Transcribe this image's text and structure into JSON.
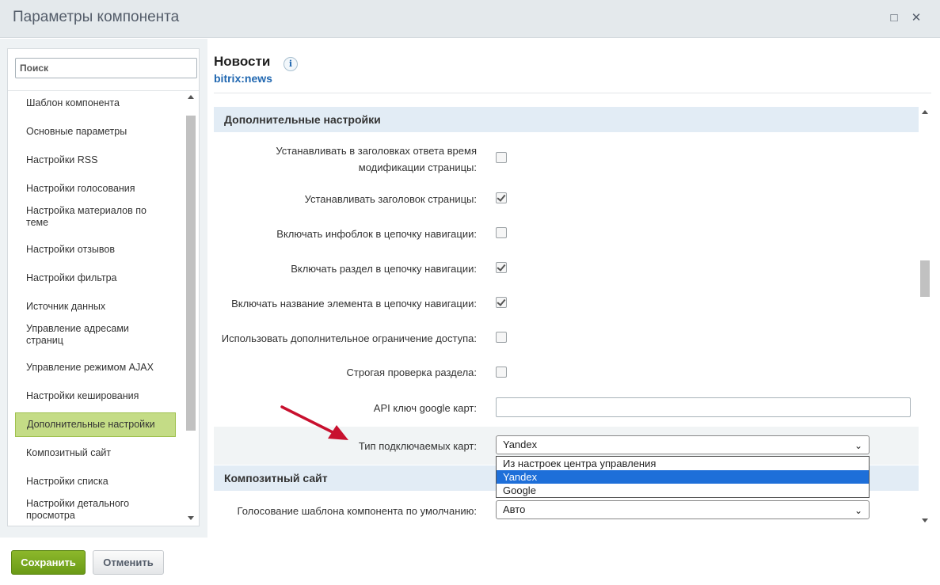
{
  "window": {
    "title": "Параметры компонента"
  },
  "sidebar": {
    "search_placeholder": "Поиск",
    "items": [
      "Шаблон компонента",
      "Основные параметры",
      "Настройки RSS",
      "Настройки голосования",
      "Настройка материалов по теме",
      "Настройки отзывов",
      "Настройки фильтра",
      "Источник данных",
      "Управление адресами страниц",
      "Управление режимом AJAX",
      "Настройки кеширования",
      "Дополнительные настройки",
      "Композитный сайт",
      "Настройки списка",
      "Настройки детального просмотра"
    ],
    "active_item": "Дополнительные настройки"
  },
  "component": {
    "title": "Новости",
    "code": "bitrix:news"
  },
  "sections": {
    "additional": {
      "title": "Дополнительные настройки",
      "rows": [
        {
          "label": "Устанавливать в заголовках ответа время модификации страницы:",
          "checked": false
        },
        {
          "label": "Устанавливать заголовок страницы:",
          "checked": true
        },
        {
          "label": "Включать инфоблок в цепочку навигации:",
          "checked": false
        },
        {
          "label": "Включать раздел в цепочку навигации:",
          "checked": true
        },
        {
          "label": "Включать название элемента в цепочку навигации:",
          "checked": true
        },
        {
          "label": "Использовать дополнительное ограничение доступа:",
          "checked": false
        },
        {
          "label": "Строгая проверка раздела:",
          "checked": false
        }
      ],
      "api_key_label": "API ключ google карт:",
      "api_key_value": "",
      "map_type_label": "Тип подключаемых карт:",
      "map_type_value": "Yandex",
      "map_type_options": [
        "Из настроек центра управления",
        "Yandex",
        "Google"
      ]
    },
    "composite": {
      "title": "Композитный сайт",
      "vote_label": "Голосование шаблона компонента по умолчанию:",
      "vote_value": "Авто"
    }
  },
  "footer": {
    "save_label": "Сохранить",
    "cancel_label": "Отменить"
  },
  "colors": {
    "accent_green": "#6e9b18",
    "link_blue": "#2067b0",
    "annotation_arrow": "#c8102e"
  }
}
